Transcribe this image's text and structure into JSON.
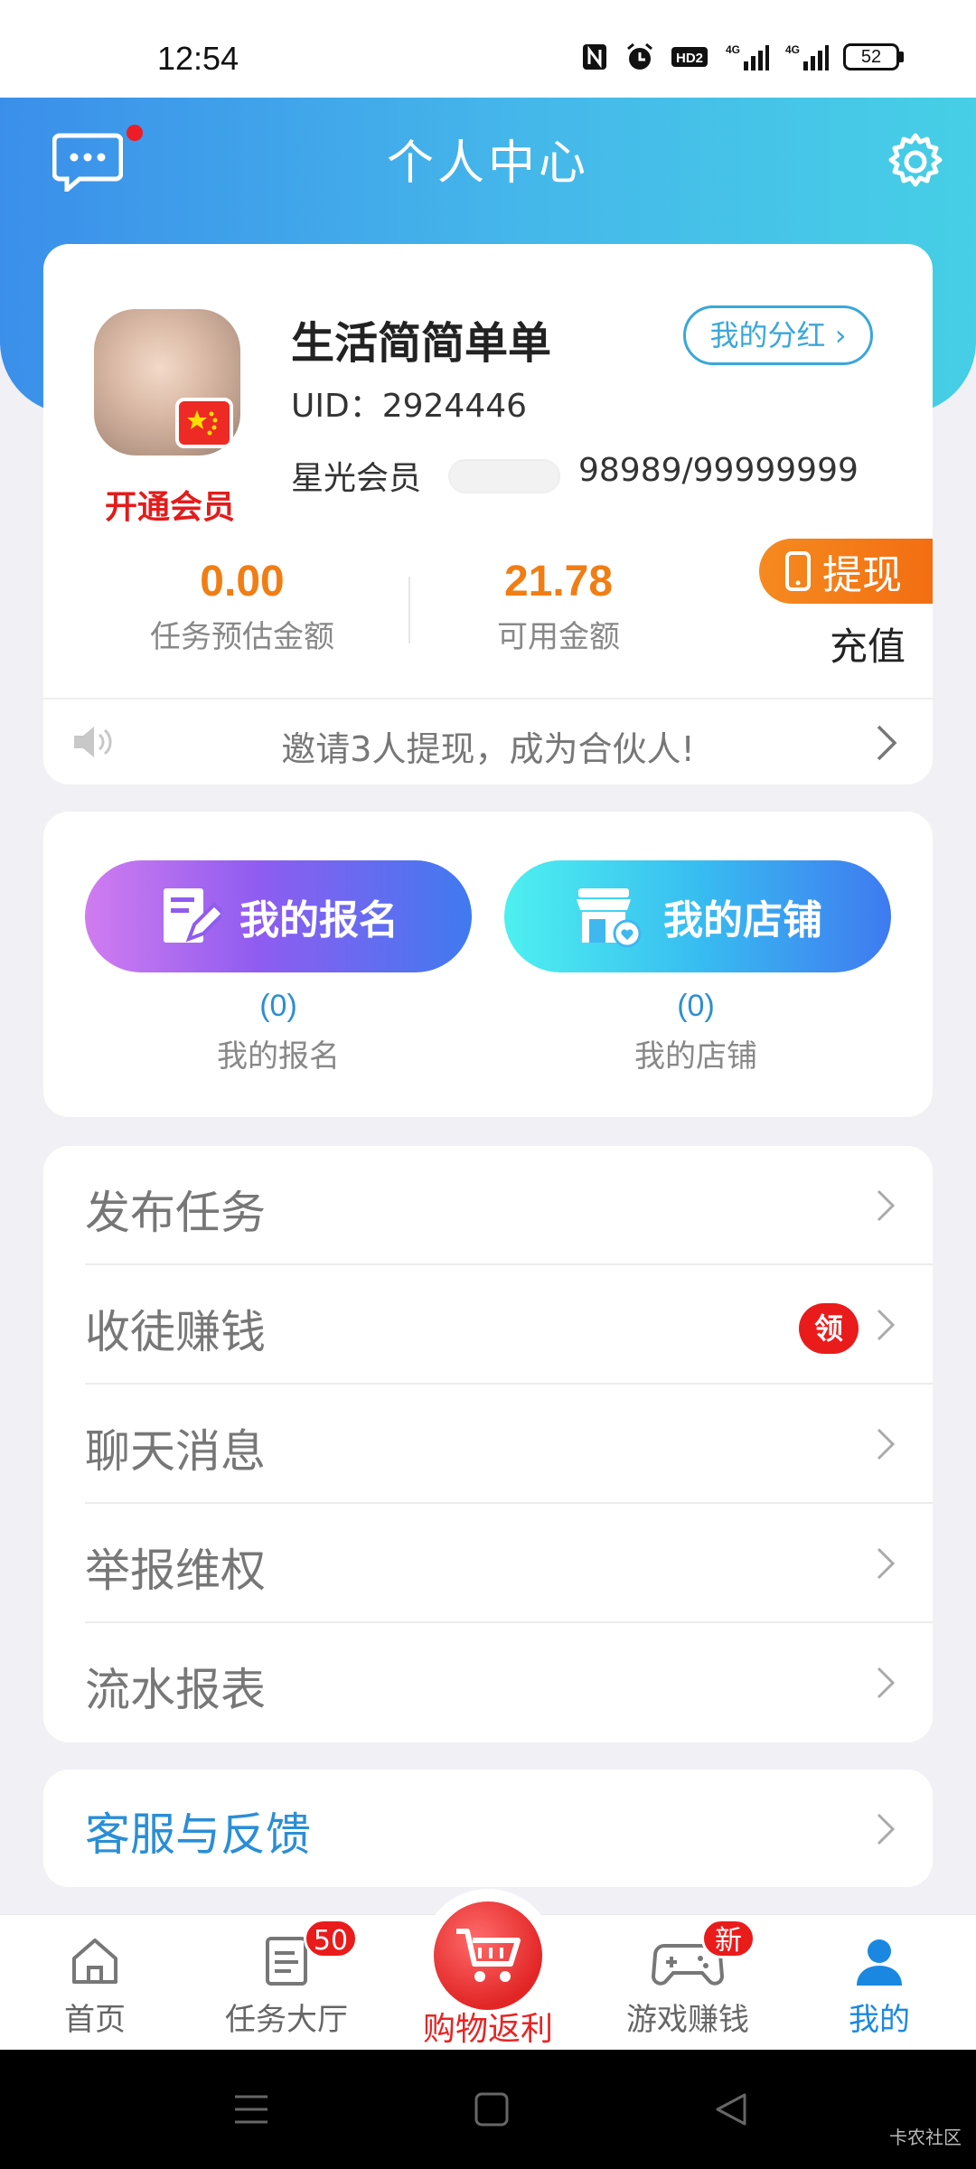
{
  "status_bar": {
    "time": "12:54",
    "battery": "52"
  },
  "header": {
    "title": "个人中心"
  },
  "profile": {
    "username": "生活简简单单",
    "uid_label": "UID：",
    "uid": "2924446",
    "fenhong_label": "我的分红",
    "vip_open": "开通会员",
    "level_name": "星光会员",
    "points": "98989/99999999",
    "estimate_value": "0.00",
    "estimate_label": "任务预估金额",
    "available_value": "21.78",
    "available_label": "可用金额",
    "withdraw_label": "提现",
    "recharge_label": "充值",
    "notice": "邀请3人提现，成为合伙人!"
  },
  "registrations": {
    "reg_button": "我的报名",
    "reg_count": "(0)",
    "reg_label": "我的报名",
    "shop_button": "我的店铺",
    "shop_count": "(0)",
    "shop_label": "我的店铺"
  },
  "menu": {
    "items": [
      {
        "label": "发布任务"
      },
      {
        "label": "收徒赚钱",
        "badge": "领"
      },
      {
        "label": "聊天消息"
      },
      {
        "label": "举报维权"
      },
      {
        "label": "流水报表"
      }
    ],
    "kefu": "客服与反馈"
  },
  "tabbar": {
    "home": "首页",
    "tasks": "任务大厅",
    "tasks_badge": "50",
    "shop": "购物返利",
    "game": "游戏赚钱",
    "game_badge": "新",
    "me": "我的"
  },
  "watermark": "卡农社区",
  "colors": {
    "accent": "#3aa7d9",
    "orange": "#f07e14",
    "red": "#ea1b1b",
    "active_tab": "#1a88e0"
  }
}
